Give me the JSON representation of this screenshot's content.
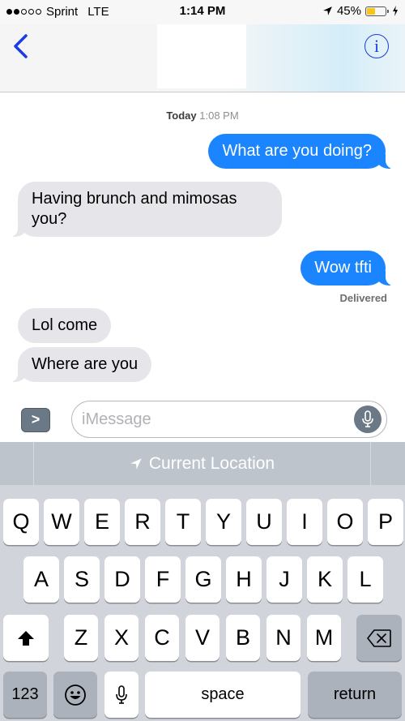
{
  "status_bar": {
    "signal_bars_filled": 2,
    "signal_bars_total": 5,
    "carrier": "Sprint",
    "network": "LTE",
    "time": "1:14 PM",
    "battery_percent_label": "45%",
    "battery_level": 0.45,
    "battery_color": "#f5c518"
  },
  "nav": {
    "back_icon": "chevron-left-icon",
    "info_label": "i",
    "accent_color": "#1a3be6"
  },
  "thread": {
    "timestamp_day": "Today",
    "timestamp_time": "1:08 PM",
    "messages": [
      {
        "direction": "outgoing",
        "text": "What are you doing?"
      },
      {
        "direction": "incoming",
        "text": "Having brunch and mimosas you?"
      },
      {
        "direction": "outgoing",
        "text": "Wow tfti"
      },
      {
        "direction": "incoming",
        "text": "Lol come"
      },
      {
        "direction": "incoming",
        "text": "Where are you"
      }
    ],
    "delivered_label": "Delivered",
    "outgoing_color": "#1a85ff",
    "incoming_color": "#e5e5ea"
  },
  "composer": {
    "apps_button_label": ">",
    "input_value": "",
    "input_placeholder": "iMessage"
  },
  "keyboard": {
    "suggestion": "Current Location",
    "row1": [
      "Q",
      "W",
      "E",
      "R",
      "T",
      "Y",
      "U",
      "I",
      "O",
      "P"
    ],
    "row2": [
      "A",
      "S",
      "D",
      "F",
      "G",
      "H",
      "J",
      "K",
      "L"
    ],
    "row3": [
      "Z",
      "X",
      "C",
      "V",
      "B",
      "N",
      "M"
    ],
    "numbers_label": "123",
    "space_label": "space",
    "return_label": "return"
  }
}
